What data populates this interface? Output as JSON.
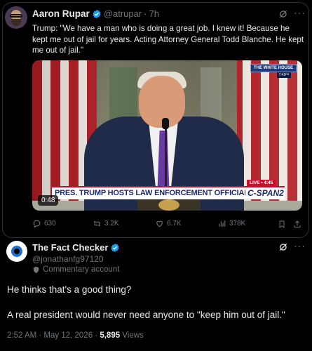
{
  "quoted_tweet": {
    "author_name": "Aaron Rupar",
    "author_handle": "@atrupar",
    "separator": "·",
    "time": "7h",
    "text": "Trump: \"We have a man who is doing a great job. I knew it! Because he kept me out of jail for years. Acting Attorney General Todd Blanche. He kept me out of jail.\"",
    "video": {
      "white_house_badge": "THE WHITE HOUSE",
      "white_house_time": "7:45ᴾᴹ",
      "live_label": "LIVE • 4:45",
      "lower_third": "PRES. TRUMP HOSTS LAW ENFORCEMENT OFFICIALS",
      "network": "C-SPAN2",
      "duration": "0:48"
    },
    "actions": {
      "replies": "630",
      "reposts": "3.2K",
      "likes": "6.7K",
      "views": "378K"
    }
  },
  "main_tweet": {
    "author_name": "The Fact Checker",
    "author_handle": "@jonathanfg97120",
    "commentary_label": "Commentary account",
    "paragraph1": "He thinks that's a good thing?",
    "paragraph2": "A real president would never need anyone to \"keep him out of jail.\"",
    "timestamp": "2:52 AM · May 12, 2026 · ",
    "views_count": "5,895",
    "views_label": "Views"
  },
  "colors": {
    "background": "#000000",
    "text": "#e7e9ea",
    "secondary": "#71767b",
    "verified": "#1d9bf0",
    "border": "#2f3336"
  }
}
